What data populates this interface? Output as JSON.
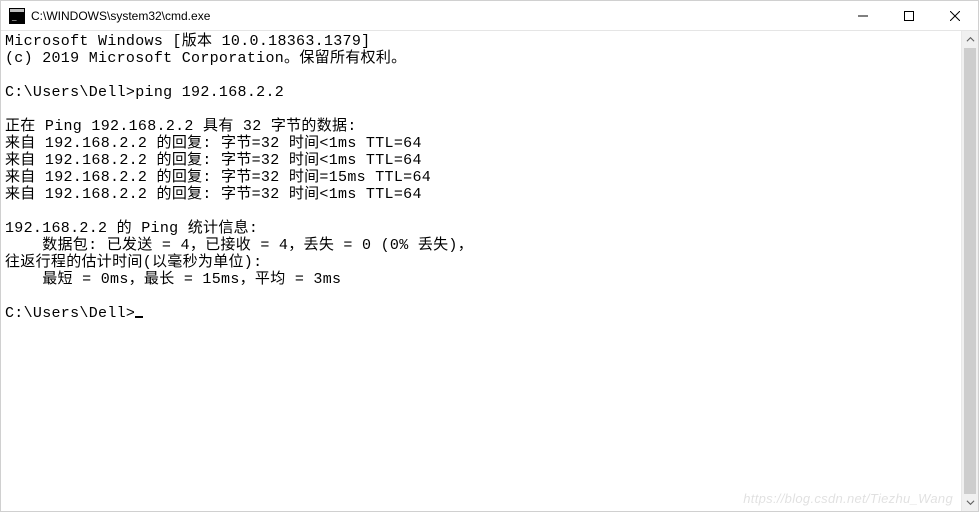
{
  "window": {
    "title": "C:\\WINDOWS\\system32\\cmd.exe"
  },
  "console": {
    "header1": "Microsoft Windows [版本 10.0.18363.1379]",
    "header2": "(c) 2019 Microsoft Corporation。保留所有权利。",
    "prompt1": "C:\\Users\\Dell>ping 192.168.2.2",
    "ping_header": "正在 Ping 192.168.2.2 具有 32 字节的数据:",
    "reply1": "来自 192.168.2.2 的回复: 字节=32 时间<1ms TTL=64",
    "reply2": "来自 192.168.2.2 的回复: 字节=32 时间<1ms TTL=64",
    "reply3": "来自 192.168.2.2 的回复: 字节=32 时间=15ms TTL=64",
    "reply4": "来自 192.168.2.2 的回复: 字节=32 时间<1ms TTL=64",
    "stats_header": "192.168.2.2 的 Ping 统计信息:",
    "stats_packets": "    数据包: 已发送 = 4，已接收 = 4，丢失 = 0 (0% 丢失)，",
    "rtt_header": "往返行程的估计时间(以毫秒为单位):",
    "rtt_values": "    最短 = 0ms，最长 = 15ms，平均 = 3ms",
    "prompt2": "C:\\Users\\Dell>"
  },
  "watermark": "https://blog.csdn.net/Tiezhu_Wang",
  "chart_data": {
    "type": "table",
    "title": "Ping 192.168.2.2 results",
    "columns": [
      "reply_from",
      "bytes",
      "time",
      "ttl"
    ],
    "rows": [
      [
        "192.168.2.2",
        32,
        "<1ms",
        64
      ],
      [
        "192.168.2.2",
        32,
        "<1ms",
        64
      ],
      [
        "192.168.2.2",
        32,
        "15ms",
        64
      ],
      [
        "192.168.2.2",
        32,
        "<1ms",
        64
      ]
    ],
    "statistics": {
      "sent": 4,
      "received": 4,
      "lost": 0,
      "loss_pct": 0,
      "rtt_min_ms": 0,
      "rtt_max_ms": 15,
      "rtt_avg_ms": 3
    }
  }
}
